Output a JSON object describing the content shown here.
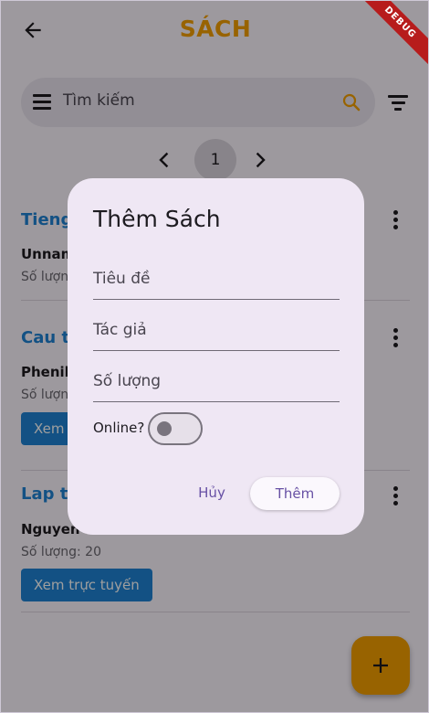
{
  "appbar": {
    "title": "SÁCH",
    "debug_banner": "DEBUG"
  },
  "search": {
    "placeholder": "Tìm kiếm"
  },
  "pager": {
    "current_page": "1"
  },
  "books": [
    {
      "title": "Tieng",
      "author": "Unnam",
      "quantity": "Số lượn"
    },
    {
      "title": "Cau tr",
      "author": "Phenik",
      "quantity": "Số lượn",
      "online_button": "Xem"
    },
    {
      "title": "Lap tr",
      "author": "Nguyen L",
      "quantity": "Số lượng: 20",
      "online_button": "Xem trực tuyến"
    }
  ],
  "dialog": {
    "title": "Thêm Sách",
    "fields": [
      {
        "placeholder": "Tiêu đề"
      },
      {
        "placeholder": "Tác giả"
      },
      {
        "placeholder": "Số lượng"
      }
    ],
    "online_label": "Online?",
    "online_value": false,
    "cancel_label": "Hủy",
    "add_label": "Thêm"
  },
  "colors": {
    "accent": "#f5a100",
    "link": "#1f84d6",
    "dialog_bg": "#efe7f4",
    "primary": "#6750a4"
  },
  "icons": {
    "back": "arrow-left-icon",
    "menu": "menu-icon",
    "search": "search-icon",
    "filter": "filter-icon",
    "prev": "chevron-left-icon",
    "next": "chevron-right-icon",
    "more": "more-vert-icon",
    "fab": "plus-icon"
  }
}
